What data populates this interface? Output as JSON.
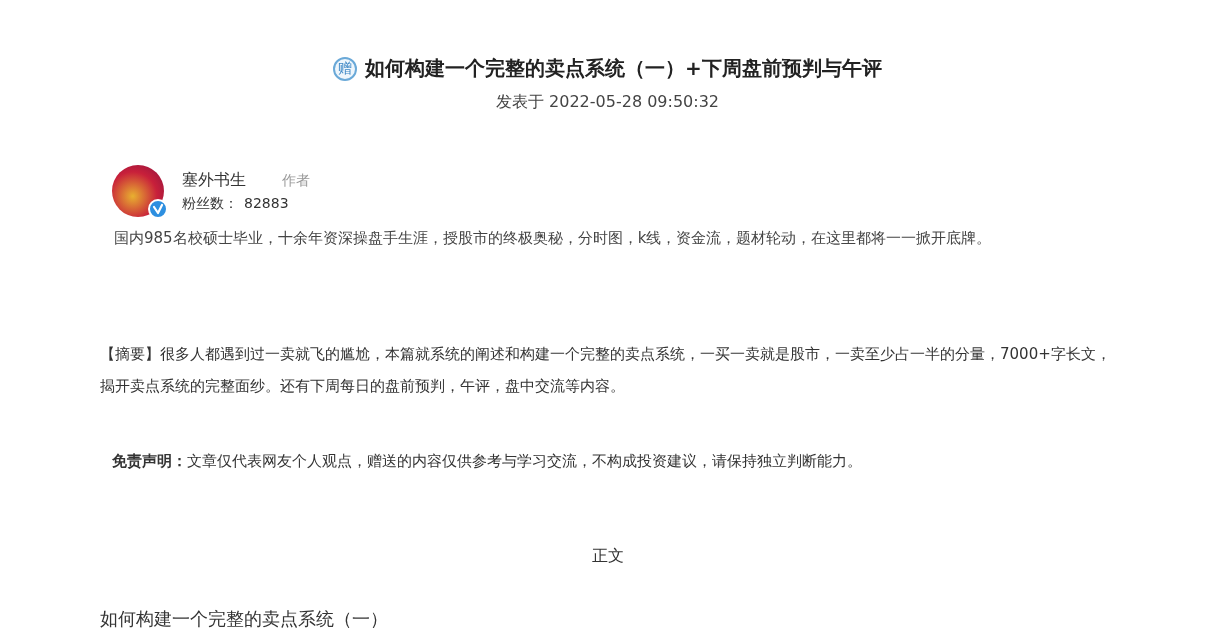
{
  "article": {
    "badge": "赠",
    "title": "如何构建一个完整的卖点系统（一）+下周盘前预判与午评",
    "published": "发表于 2022-05-28 09:50:32"
  },
  "author": {
    "name": "塞外书生",
    "role": "作者",
    "verified": true,
    "followers_label": "粉丝数：",
    "followers": "82883",
    "bio": "国内985名校硕士毕业，十余年资深操盘手生涯，授股市的终极奥秘，分时图，k线，资金流，题材轮动，在这里都将一一掀开底牌。"
  },
  "summary": "【摘要】很多人都遇到过一卖就飞的尴尬，本篇就系统的阐述和构建一个完整的卖点系统，一买一卖就是股市，一卖至少占一半的分量，7000+字长文，揭开卖点系统的完整面纱。还有下周每日的盘前预判，午评，盘中交流等内容。",
  "disclaimer": "**免责声明：**文章仅代表网友个人观点，赠送的内容仅供参考与学习交流，不构成投资建议，请保持独立判断能力。",
  "body_label": "正文",
  "section_heading": "如何构建一个完整的卖点系统（一）"
}
